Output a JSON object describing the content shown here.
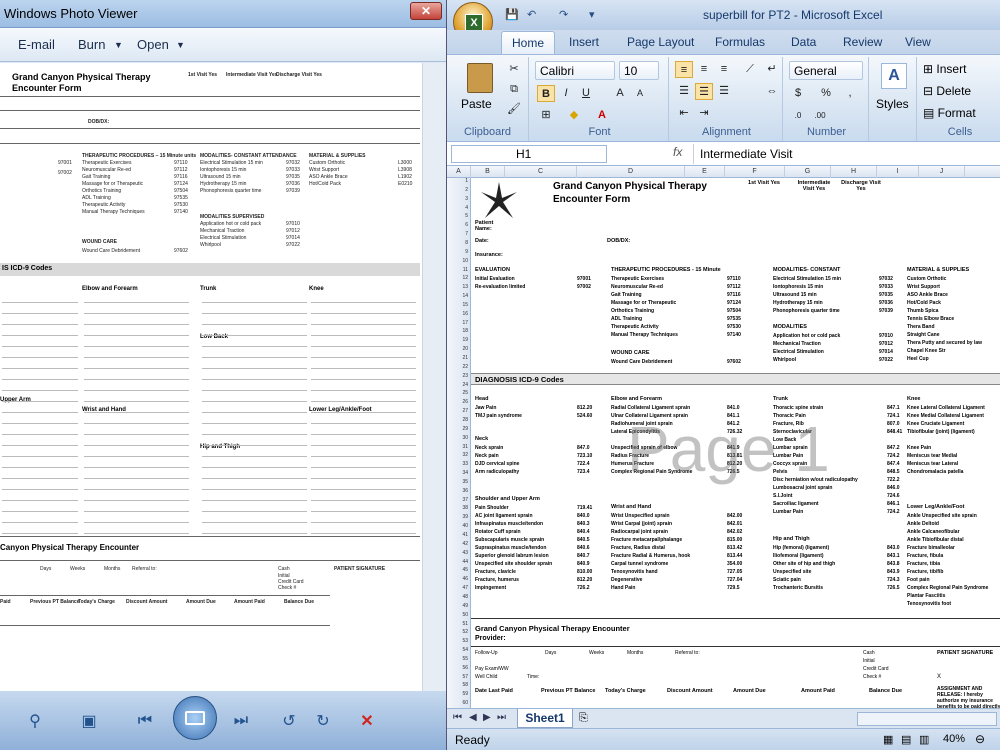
{
  "photo_viewer": {
    "title": "Windows Photo Viewer",
    "menu": [
      "E-mail",
      "Burn",
      "Open"
    ],
    "doc": {
      "title_line1": "Grand Canyon Physical Therapy",
      "title_line2": "Encounter Form",
      "visit_headers": [
        "1st Visit Yes",
        "Intermediate Visit Yes",
        "Discharge Visit Yes"
      ],
      "dob": "DOB/DX:",
      "col_heads": [
        "THERAPEUTIC PROCEDURES – 15 Minute units",
        "MODALITIES- CONSTANT ATTENDANCE",
        "MATERIAL & SUPPLIES"
      ],
      "codes_left": [
        "97001",
        "97002"
      ],
      "proc_rows": [
        [
          "Therapeutic Exercises",
          "97110"
        ],
        [
          "Neuromuscular Re-ed",
          "97112"
        ],
        [
          "Gait Training",
          "97116"
        ],
        [
          "Massage for or Therapeutic",
          "97124"
        ],
        [
          "Orthotics Training",
          "97504"
        ],
        [
          "ADL Training",
          "97535"
        ],
        [
          "Therapeutic Activity",
          "97530"
        ],
        [
          "Manual Therapy Techniques",
          "97140"
        ]
      ],
      "mod_rows": [
        [
          "Electrical Stimulation 15 min",
          "97032"
        ],
        [
          "Iontophoresis 15 min",
          "97033"
        ],
        [
          "Ultrasound 15 min",
          "97035"
        ],
        [
          "Hydrotherapy 15 min",
          "97036"
        ],
        [
          "Phonophoresis quarter time",
          "97039"
        ]
      ],
      "supply_rows": [
        [
          "Custom Orthotic",
          "L3000"
        ],
        [
          "Wrist Support",
          "L3908"
        ],
        [
          "ASO Ankle Brace",
          "L1902"
        ],
        [
          "Hot/Cold Pack",
          "E0210"
        ],
        [
          "Thumb Spica",
          "L3895"
        ],
        [
          "Tennis Elbow Brace",
          "L3999"
        ],
        [
          "Thera Band",
          "A4600"
        ],
        [
          "Straight Cane",
          "E0100"
        ],
        [
          "Thera Putty",
          "A9900"
        ],
        [
          "Chapel Knee Str",
          "L1825"
        ],
        [
          "Heel Cup",
          "L3485"
        ]
      ],
      "supervised": "MODALITIES SUPERVISED",
      "sup_rows": [
        [
          "Application hot or cold pack",
          "97010"
        ],
        [
          "Mechanical Traction",
          "97012"
        ],
        [
          "Electrical Stimulation",
          "97014"
        ],
        [
          "Whirlpool",
          "97022"
        ]
      ],
      "wound": "WOUND CARE",
      "wound_row": [
        "Wound Care Debridement",
        "97602"
      ],
      "section": "IS  ICD-9 Codes",
      "regions": [
        "Elbow and Forearm",
        "Trunk",
        "Knee",
        "Low Back",
        "Upper Arm",
        "Wrist and Hand",
        "Lower Leg/Ankle/Foot",
        "Hip and Thigh"
      ],
      "footer_title": "Canyon  Physical Therapy Encounter",
      "footer_row": [
        "Days",
        "Weeks",
        "Months",
        "Referral to:"
      ],
      "pay_heads": [
        "Paid",
        "Previous PT Balance",
        "Today's Charge",
        "Discount Amount",
        "Amount Due",
        "Amount Paid",
        "Balance Due"
      ],
      "sig": "PATIENT SIGNATURE",
      "cash": [
        "Cash",
        "Initial",
        "Credit Card",
        "Check #"
      ]
    }
  },
  "excel": {
    "title": "superbill for PT2 - Microsoft Excel",
    "orb_letter": "X",
    "tabs": [
      "Home",
      "Insert",
      "Page Layout",
      "Formulas",
      "Data",
      "Review",
      "View"
    ],
    "font": {
      "name": "Calibri",
      "size": "10"
    },
    "number_format": "General",
    "groups": [
      "Clipboard",
      "Font",
      "Alignment",
      "Number",
      "Styles",
      "Cells"
    ],
    "cells_buttons": [
      "Insert",
      "Delete",
      "Format"
    ],
    "paste": "Paste",
    "styles": "Styles",
    "name_box": "H1",
    "fx": "fx",
    "formula": "Intermediate Visit",
    "columns": [
      "A",
      "B",
      "C",
      "D",
      "E",
      "F",
      "G",
      "H",
      "I",
      "J",
      "K"
    ],
    "rows": [
      "1",
      "2",
      "3",
      "4",
      "5",
      "6",
      "7",
      "8",
      "9",
      "10",
      "11",
      "12",
      "13",
      "14",
      "15",
      "16",
      "17",
      "18",
      "19",
      "20",
      "21",
      "22",
      "23",
      "24",
      "25",
      "26",
      "27",
      "28",
      "29",
      "30",
      "31",
      "32",
      "33",
      "34",
      "35",
      "36",
      "37",
      "38",
      "39",
      "40",
      "41",
      "42",
      "43",
      "44",
      "45",
      "46",
      "47",
      "48",
      "49",
      "50",
      "51",
      "52",
      "53",
      "54",
      "55",
      "56",
      "57",
      "58",
      "59",
      "60"
    ],
    "sheet": {
      "title1": "Grand Canyon Physical Therapy",
      "title2": "Encounter Form",
      "visit1": "1st Visit Yes",
      "visit2": "Intermediate Visit Yes",
      "visit3": "Discharge Visit Yes",
      "patient": "Patient Name:",
      "date": "Date:",
      "insurance": "Insurance:",
      "dobdx": "DOB/DX:",
      "evaluation": "EVALUATION",
      "eval_rows": [
        [
          "Initial Evaluation",
          "97001"
        ],
        [
          "Re-evaluation limited",
          "97002"
        ]
      ],
      "tp_head": "THERAPEUTIC PROCEDURES - 15 Minute",
      "tp_rows": [
        [
          "Therapeutic Exercises",
          "97110"
        ],
        [
          "Neuromuscular Re-ed",
          "97112"
        ],
        [
          "Gait Training",
          "97116"
        ],
        [
          "Massage for or Therapeutic",
          "97124"
        ],
        [
          "Orthotics Training",
          "97504"
        ],
        [
          "ADL Training",
          "97535"
        ],
        [
          "Therapeutic Activity",
          "97530"
        ],
        [
          "Manual Therapy Techniques",
          "97140"
        ]
      ],
      "mod_head": "MODALITIES- CONSTANT",
      "mod_rows": [
        [
          "Electrical Stimulation 15 min",
          "97032"
        ],
        [
          "Iontophoresis 15 min",
          "97033"
        ],
        [
          "Ultrasound 15 min",
          "97035"
        ],
        [
          "Hydrotherapy 15 min",
          "97036"
        ],
        [
          "Phonophoresis quarter time",
          "97039"
        ]
      ],
      "modalities": "MODALITIES",
      "mod2_rows": [
        [
          "Application hot or cold pack",
          "97010"
        ],
        [
          "Mechanical Traction",
          "97012"
        ],
        [
          "Electrical Stimulation",
          "97014"
        ],
        [
          "Whirlpool",
          "97022"
        ]
      ],
      "sup_head": "MATERIAL & SUPPLIES",
      "sup_rows": [
        "Custom Orthotic",
        "Wrist Support",
        "ASO Ankle Brace",
        "Hot/Cold Pack",
        "Thumb Spica",
        "Tennis Elbow Brace",
        "Thera Band",
        "Straight Cane",
        "Thera Putty and secured by law",
        "Chapel Knee Str",
        "Heel Cup"
      ],
      "wound": "WOUND CARE",
      "wound_row": [
        "Wound Care Debridement",
        "97602"
      ],
      "diag": "DIAGNOSIS ICD-9 Codes",
      "head": "Head",
      "elbow": "Elbow and Forearm",
      "trunk": "Trunk",
      "knee": "Knee",
      "head_rows": [
        [
          "Jaw Pain",
          "812.20"
        ],
        [
          "TMJ pain syndrome",
          "524.60"
        ]
      ],
      "elbow_rows": [
        [
          "Radial Collateral Ligament sprain",
          "841.0"
        ],
        [
          "Ulnar Collateral Ligament sprain",
          "841.1"
        ],
        [
          "Radiohumeral joint sprain",
          "841.2"
        ],
        [
          "Lateral Epicondylitis",
          "726.32"
        ],
        [
          "Unspecified sprain of elbow",
          "841.9"
        ],
        [
          "Radius Fracture",
          "813.81"
        ],
        [
          "Humerus Fracture",
          "812.20"
        ],
        [
          "Complex Regional Pain Syndrome",
          "726.5"
        ]
      ],
      "trunk_rows": [
        [
          "Thoracic spine strain",
          "847.1"
        ],
        [
          "Thoracic Pain",
          "724.1"
        ],
        [
          "Fracture, Rib",
          "807.0"
        ],
        [
          "Sternoclavicular",
          "848.41"
        ],
        [
          "Low Back",
          "724.2"
        ],
        [
          "Lumbar sprain",
          "847.2"
        ],
        [
          "Lumbar Pain",
          "724.2"
        ],
        [
          "Coccyx sprain",
          "847.4"
        ],
        [
          "Pelvis",
          "848.5"
        ],
        [
          "Disc herniation w/out radiculopathy",
          "722.2"
        ],
        [
          "Lumbosacral joint sprain",
          "846.0"
        ],
        [
          "S.I.Joint",
          "724.6"
        ],
        [
          "Sacroiliac ligament",
          "846.1"
        ],
        [
          "Lumbar Pain",
          "724.2"
        ]
      ],
      "knee_rows": [
        [
          "Knee Lateral Collateral Ligament",
          "844.0"
        ],
        [
          "Knee Medial Collateral Ligament",
          "844.1"
        ],
        [
          "Knee Cruciate Ligament",
          "844.2"
        ],
        [
          "Tibiofibular (joint) (ligament)",
          "844.3"
        ],
        [
          "Knee Pain",
          "719.46"
        ],
        [
          "Meniscus tear Medial",
          "836.0"
        ],
        [
          "Meniscus tear Lateral",
          "836.1"
        ],
        [
          "Chondromalacia patella",
          "717.7"
        ]
      ],
      "neck": "Neck",
      "neck_rows": [
        [
          "Neck sprain",
          "847.0"
        ],
        [
          "Neck pain",
          "723.10"
        ],
        [
          "DJD cervical spine",
          "722.4"
        ],
        [
          "Arm radiculopathy",
          "723.4"
        ]
      ],
      "shoulder": "Shoulder and Upper Arm",
      "shoulder_rows": [
        [
          "Pain Shoulder",
          "719.41"
        ],
        [
          "AC joint ligament sprain",
          "840.0"
        ],
        [
          "Infraspinatus muscle/tendon",
          "840.3"
        ],
        [
          "Rotator Cuff sprain",
          "840.4"
        ],
        [
          "Subscapularis muscle sprain",
          "840.5"
        ],
        [
          "Supraspinatus muscle/tendon",
          "840.6"
        ],
        [
          "Superior glenoid labrum lesion",
          "840.7"
        ],
        [
          "Unspecified site shoulder sprain",
          "840.9"
        ],
        [
          "Fracture, clavicle",
          "810.00"
        ],
        [
          "Fracture, humerus",
          "812.20"
        ],
        [
          "Impingement",
          "726.2"
        ]
      ],
      "wrist": "Wrist and Hand",
      "wrist_rows": [
        [
          "Wrist Unspecified sprain",
          "842.00"
        ],
        [
          "Wrist Carpal (joint) sprain",
          "842.01"
        ],
        [
          "Radiocarpal joint sprain",
          "842.02"
        ],
        [
          "Fracture metacarpal/phalange",
          "815.00"
        ],
        [
          "Fracture, Radius distal",
          "813.42"
        ],
        [
          "Fracture Radial & Humerus, hook",
          "813.44"
        ],
        [
          "Carpal tunnel syndrome",
          "354.00"
        ],
        [
          "Tenosynovitis hand",
          "727.05"
        ],
        [
          "Degenerative",
          "727.04"
        ],
        [
          "Hand Pain",
          "729.5"
        ]
      ],
      "hip": "Hip and Thigh",
      "hip_rows": [
        [
          "Hip (femoral) (ligament)",
          "843.0"
        ],
        [
          "Iliofemoral (ligament)",
          "843.1"
        ],
        [
          "Other site of hip and thigh",
          "843.8"
        ],
        [
          "Unspecified site",
          "843.9"
        ],
        [
          "Sciatic pain",
          "724.3"
        ],
        [
          "Trochanteric Bursitis",
          "726.5"
        ]
      ],
      "lower": "Lower Leg/Ankle/Foot",
      "lower_rows": [
        [
          "Ankle Unspecified site sprain",
          "845.00"
        ],
        [
          "Ankle Deltoid",
          "845.01"
        ],
        [
          "Ankle Calcaneofibular",
          "845.02"
        ],
        [
          "Ankle Tibiofibular distal",
          "845.03"
        ],
        [
          "Fracture bimalleolar",
          "824.4"
        ],
        [
          "Fracture, fibula",
          "823.81"
        ],
        [
          "Fracture, tibia",
          "823.80"
        ],
        [
          "Fracture, tib/fib",
          "823.82"
        ],
        [
          "Foot pain",
          "729.5"
        ],
        [
          "Complex Regional Pain Syndrome",
          "726.5"
        ],
        [
          "Plantar Fasciitis",
          "728.71"
        ],
        [
          "Tenosynovitis foot",
          "727.06"
        ]
      ],
      "enc_title": "Grand Canyon Physical Therapy Encounter",
      "provider": "Provider:",
      "follow": "Follow-Up",
      "days": "Days",
      "weeks": "Weeks",
      "months": "Months",
      "referral": "Referral to:",
      "pay_row": [
        "Pay Exam/WW",
        "Well Child",
        "Time:"
      ],
      "cash": [
        "Cash",
        "Initial",
        "Credit Card",
        "Check #"
      ],
      "sig": "PATIENT SIGNATURE",
      "assign": "ASSIGNMENT AND RELEASE: I hereby authorize my insurance benefits to be paid directly",
      "pay_heads": [
        "Date Last Paid",
        "Previous PT Balance",
        "Today's Charge",
        "Discount Amount",
        "Amount Due",
        "Amount Paid",
        "Balance Due"
      ],
      "x": "X"
    },
    "page_watermark": "Page 1",
    "sheet_tab": "Sheet1",
    "status": "Ready",
    "zoom": "40%"
  }
}
